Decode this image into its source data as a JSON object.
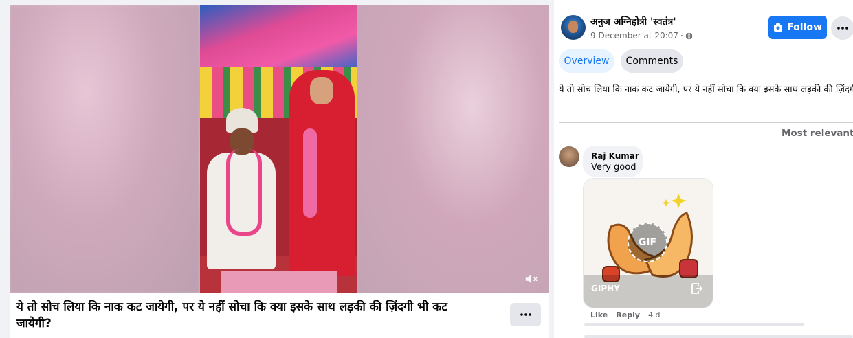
{
  "video": {
    "caption": "ये तो सोच लिया कि नाक कट जायेगी, पर ये नहीं सोचा कि क्या इसके साथ लड़की की ज़िंदगी भी कट जायेगी?",
    "mute_icon": "speaker-muted-icon",
    "more_icon": "ellipsis-icon"
  },
  "post": {
    "author": "अनुज अग्निहोत्री 'स्वतंत्र'",
    "date": "9 December at 20:07",
    "separator": "·",
    "privacy_icon": "globe-icon",
    "follow_label": "Follow",
    "options_icon": "ellipsis-icon",
    "text": "ये तो सोच लिया कि नाक कट जायेगी, पर ये नहीं सोचा कि क्या इसके साथ लड़की की ज़िंदगी भी कट जायेगी?"
  },
  "tabs": [
    {
      "label": "Overview",
      "active": true
    },
    {
      "label": "Comments",
      "active": false
    }
  ],
  "sort": {
    "label": "Most relevant",
    "icon": "caret-down-icon"
  },
  "comment": {
    "author": "Raj Kumar",
    "text": "Very good",
    "gif_badge": "GIF",
    "gif_source": "GIPHY",
    "like_label": "Like",
    "reply_label": "Reply",
    "time": "4 d"
  },
  "colors": {
    "accent": "#1877f2",
    "accent_light": "#e7f3ff",
    "secondary_bg": "#e4e6eb",
    "text_primary": "#050505",
    "text_secondary": "#65676b"
  }
}
